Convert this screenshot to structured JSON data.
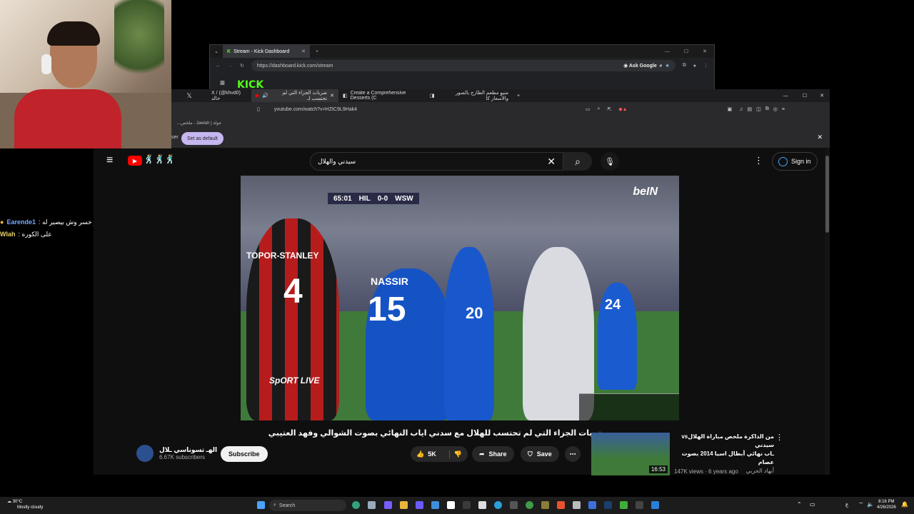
{
  "webcam": {},
  "chat": {
    "messages": [
      {
        "user": "Earende1",
        "text": "لو خسر وش بيصير له :"
      },
      {
        "user": "Wlah",
        "text": "على الكوره :"
      }
    ]
  },
  "kick_window": {
    "tab_title": "Stream - Kick Dashboard",
    "url": "https://dashboard.kick.com/stream",
    "ask_google": "Ask Google",
    "logo_text": "KICK"
  },
  "browser": {
    "tabs": [
      {
        "label": "X / (@khvd0) خالد"
      },
      {
        "label": "ضربات الجزاء التي لم تحتسب لـ"
      },
      {
        "label": "Create a Comprehensive Desserts (C"
      },
      {
        "label": "منيو مطعم الطازج بالصور والأسعار كا"
      }
    ],
    "url": "youtube.com/watch?v=HZtC9L9Hak4",
    "bookmark": "جولة | Jawlah - ملخص...",
    "bookmark_left": "ser",
    "set_default": "Set as default"
  },
  "youtube": {
    "search_value": "سيدني والهلال",
    "sign_in": "Sign in",
    "emoji_logo": "🕺🏼🕺🏼🕺🏼",
    "player": {
      "score_left": "65:01",
      "team_home": "HIL",
      "score": "0-0",
      "team_away": "WSW",
      "broadcaster": "beIN",
      "watermark": "SpORT LIVE",
      "jersey_red": "TOPOR-STANLEY",
      "jersey_red_num": "4",
      "jersey_blue": "NASSIR",
      "jersey_blue_num": "15",
      "jersey_blue2_num": "24",
      "jersey_mid_num": "20"
    },
    "video_title": "ضربات الجزاء التي لم تحتسب للهلال مع سدني اياب النهائي بصوت الشوالي وفهد العتيبي",
    "channel_name": "الهـ تسوناسي ـلال",
    "subscribers": "6.67K subscribers",
    "subscribe": "Subscribe",
    "likes": "5K",
    "share": "Share",
    "save": "Save",
    "suggestion": {
      "title_line1": "من الذاكرة ملخص مباراة الهلالvs سيدني",
      "title_line2": "ـاب نهائي أبطال اسيا 2014 بصوت عصام",
      "channel": "أبهاد الحربي",
      "meta": "147K views · 6 years ago",
      "duration": "16:53"
    }
  },
  "taskbar": {
    "weather_temp": "30°C",
    "weather_desc": "Mostly cloudy",
    "search": "Search",
    "time": "8:16 PM",
    "date": "4/26/2026",
    "lang": "ع"
  }
}
